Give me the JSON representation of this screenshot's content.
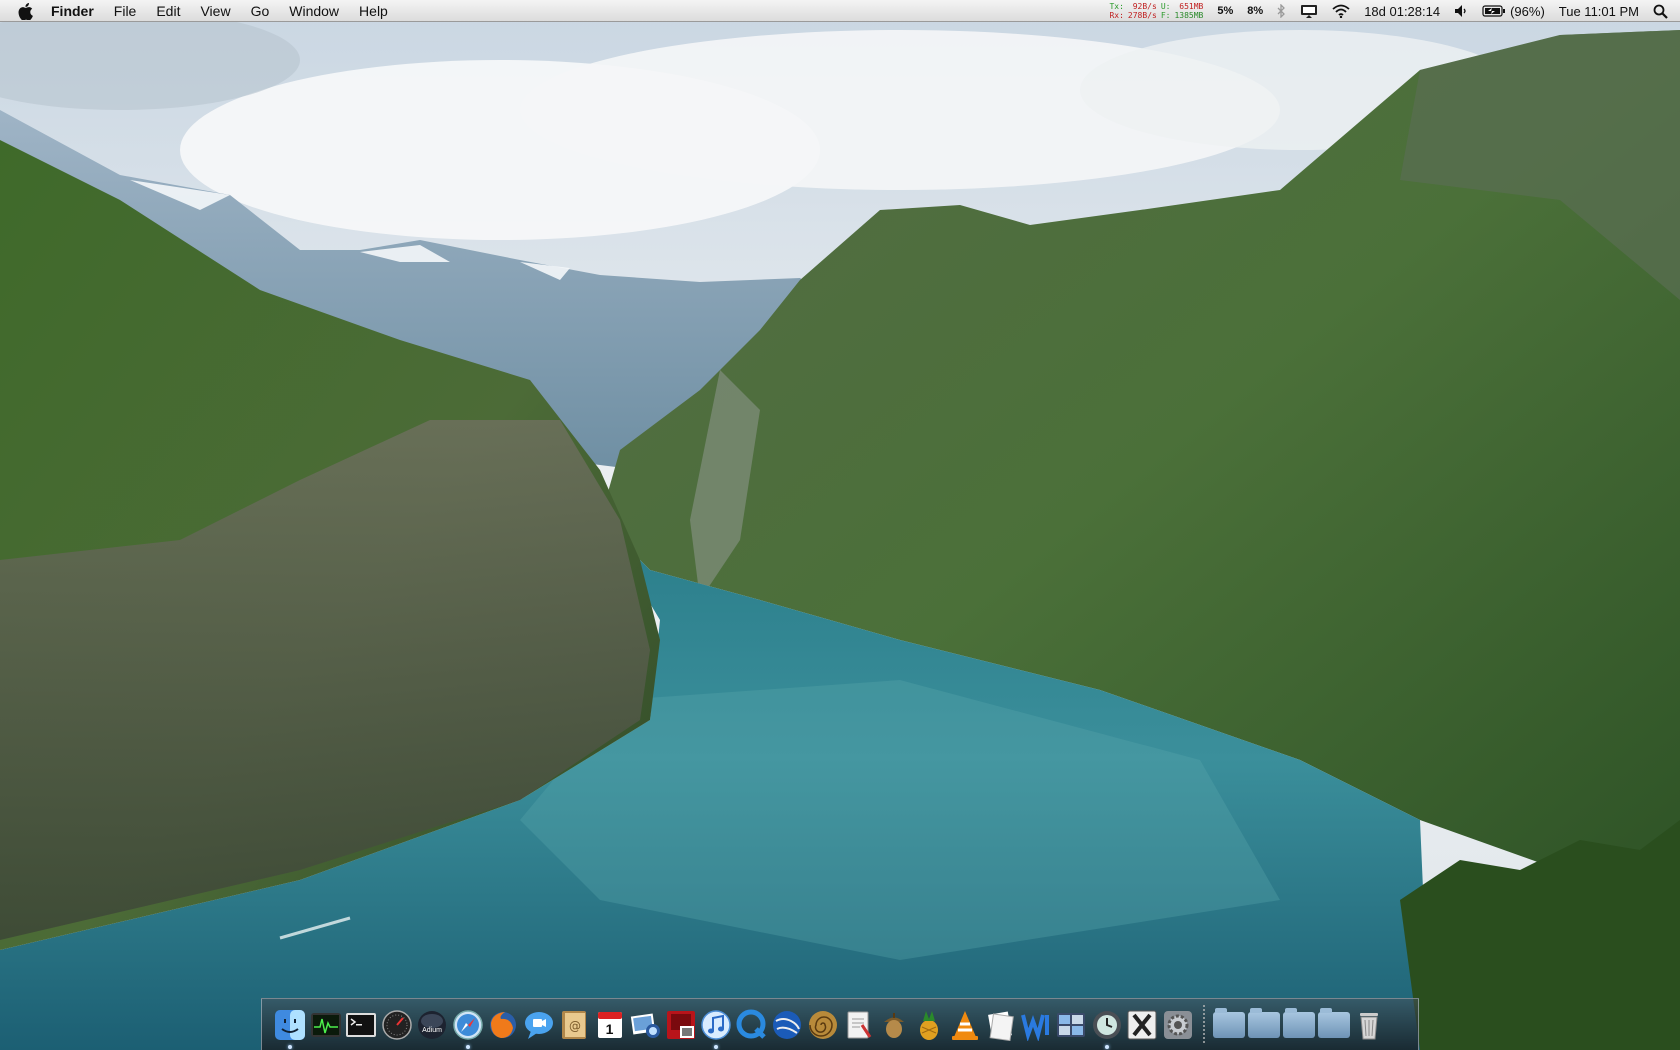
{
  "menubar": {
    "app_name": "Finder",
    "menus": [
      "File",
      "Edit",
      "View",
      "Go",
      "Window",
      "Help"
    ],
    "network": {
      "tx_label": "Tx:",
      "tx_value": "92B/s",
      "rx_label": "Rx:",
      "rx_value": "278B/s",
      "u_label": "U:",
      "u_value": "651MB",
      "f_label": "F:",
      "f_value": "1385MB"
    },
    "cpu1": "5%",
    "cpu2": "8%",
    "uptime": "18d 01:28:14",
    "battery": "(96%)",
    "clock": "Tue 11:01 PM"
  },
  "dock": {
    "apps": [
      {
        "name": "Finder",
        "icon": "finder-icon",
        "running": true
      },
      {
        "name": "Activity Monitor",
        "icon": "activity-monitor-icon",
        "running": false
      },
      {
        "name": "Terminal",
        "icon": "terminal-icon",
        "running": false
      },
      {
        "name": "Dashboard",
        "icon": "dashboard-icon",
        "running": false
      },
      {
        "name": "Adium",
        "icon": "adium-icon",
        "label": "Adium",
        "running": false
      },
      {
        "name": "Safari",
        "icon": "safari-icon",
        "running": true
      },
      {
        "name": "Firefox",
        "icon": "firefox-icon",
        "running": false
      },
      {
        "name": "iChat",
        "icon": "ichat-icon",
        "running": false
      },
      {
        "name": "Address Book",
        "icon": "address-book-icon",
        "running": false
      },
      {
        "name": "iCal",
        "icon": "ical-icon",
        "label": "1",
        "running": false
      },
      {
        "name": "iPhoto",
        "icon": "iphoto-icon",
        "running": false
      },
      {
        "name": "Photo Booth",
        "icon": "photo-booth-icon",
        "running": false
      },
      {
        "name": "iTunes",
        "icon": "itunes-icon",
        "running": true
      },
      {
        "name": "QuickTime Player",
        "icon": "quicktime-icon",
        "running": false
      },
      {
        "name": "Google Earth",
        "icon": "google-earth-icon",
        "running": false
      },
      {
        "name": "Camino",
        "icon": "spiral-app-icon",
        "running": false
      },
      {
        "name": "Script Editor",
        "icon": "script-editor-icon",
        "running": false
      },
      {
        "name": "Acorn",
        "icon": "acorn-icon",
        "running": false
      },
      {
        "name": "Cocktail",
        "icon": "pineapple-icon",
        "running": false
      },
      {
        "name": "VLC",
        "icon": "vlc-icon",
        "running": false
      },
      {
        "name": "Preview",
        "icon": "preview-icon",
        "running": false
      },
      {
        "name": "Wireshark",
        "icon": "wave-app-icon",
        "running": false
      },
      {
        "name": "Spaces",
        "icon": "spaces-icon",
        "running": false
      },
      {
        "name": "Time Machine",
        "icon": "time-machine-icon",
        "running": true
      },
      {
        "name": "X11",
        "icon": "x11-icon",
        "running": false
      },
      {
        "name": "System Preferences",
        "icon": "system-preferences-icon",
        "running": false
      }
    ],
    "stacks": [
      {
        "name": "Applications",
        "icon": "applications-folder-icon"
      },
      {
        "name": "Documents",
        "icon": "documents-folder-icon"
      },
      {
        "name": "Downloads",
        "icon": "downloads-folder-icon"
      },
      {
        "name": "Pictures",
        "icon": "pictures-folder-icon"
      }
    ],
    "trash": {
      "name": "Trash",
      "icon": "trash-icon"
    }
  }
}
